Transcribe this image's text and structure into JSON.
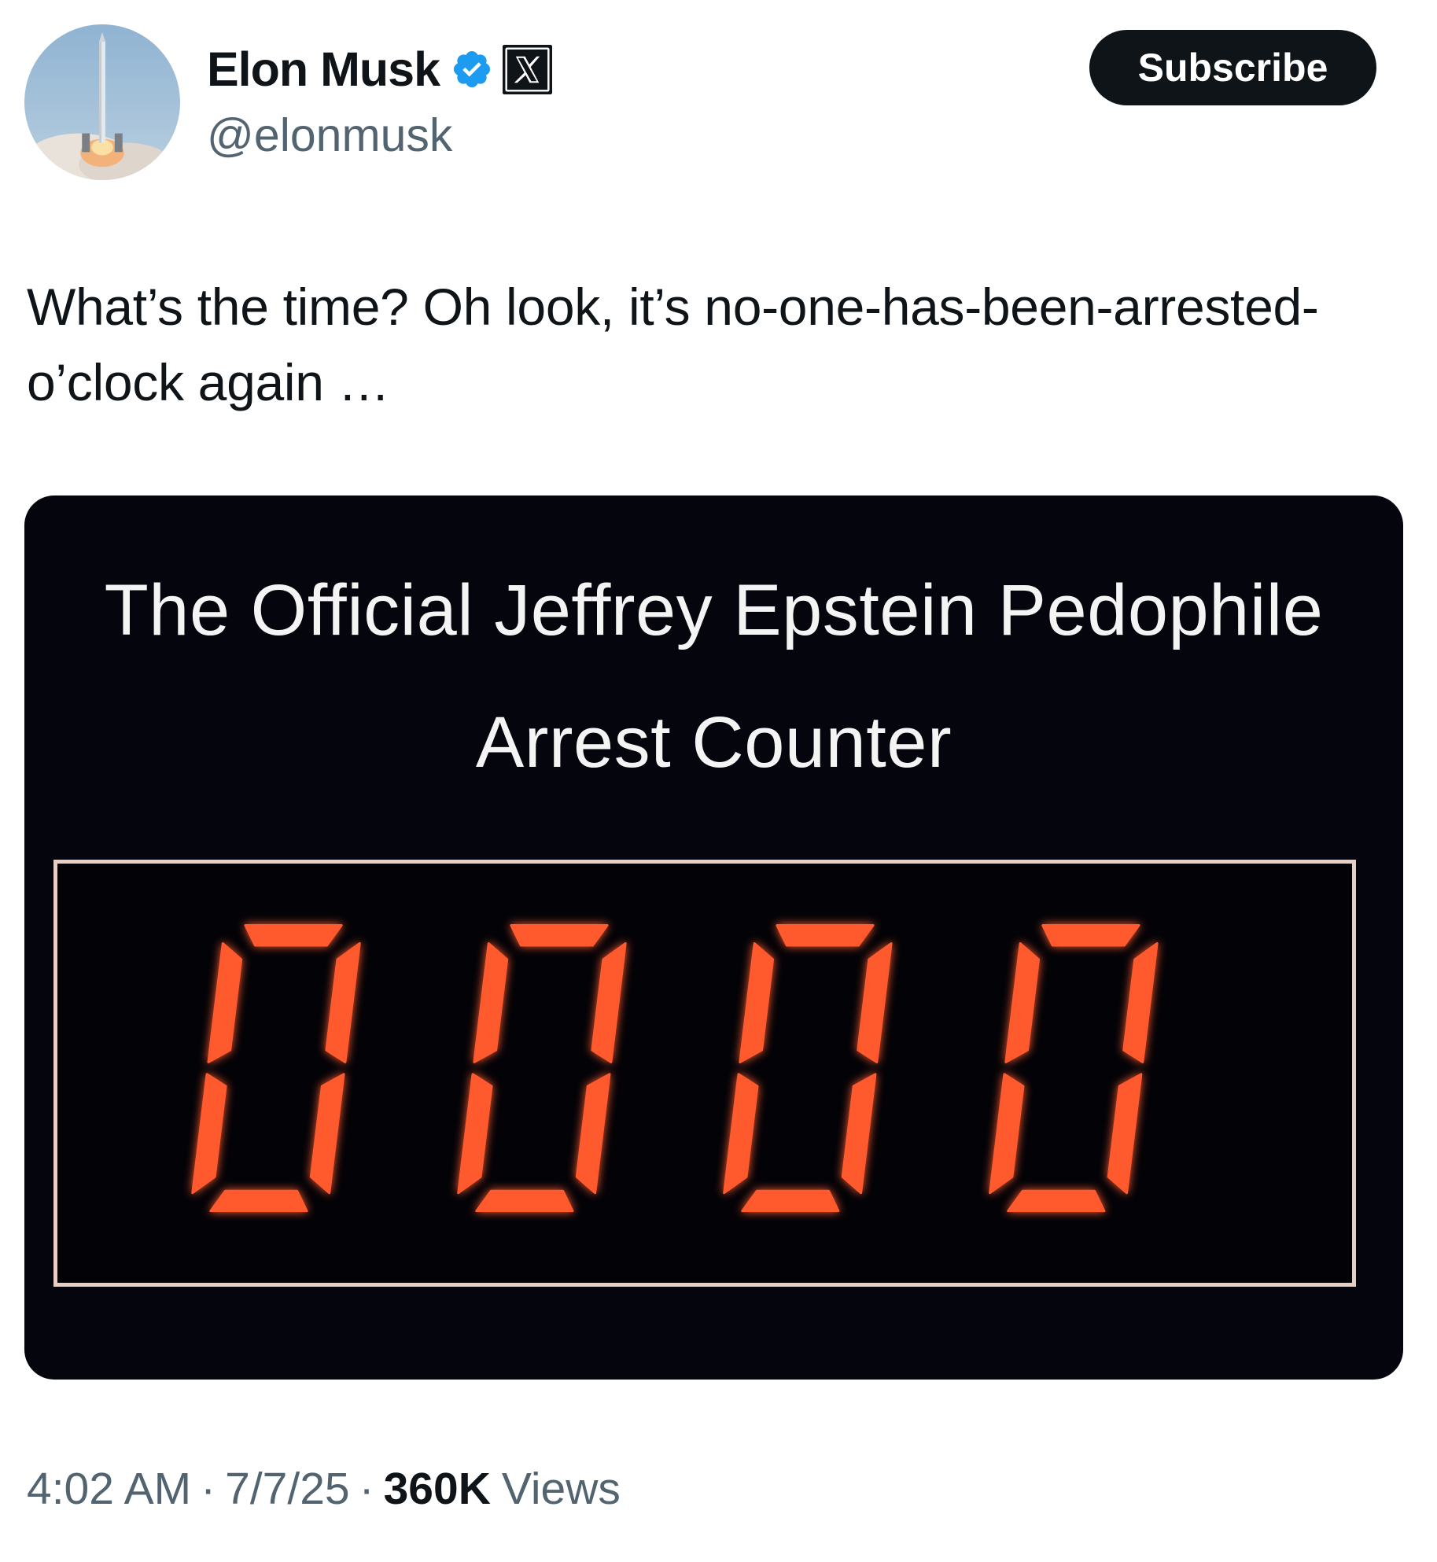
{
  "author": {
    "display_name": "Elon Musk",
    "handle": "@elonmusk",
    "avatar_icon": "rocket-launch-avatar",
    "verified_icon": "verified-badge-icon",
    "affiliate_icon": "x-logo-icon"
  },
  "actions": {
    "subscribe_label": "Subscribe"
  },
  "tweet": {
    "text": "What’s the time? Oh look, it’s no-one-has-been-arrested-o’clock again …"
  },
  "media": {
    "title": "The Official Jeffrey Epstein Pedophile Arrest Counter",
    "counter_value": "0000"
  },
  "meta": {
    "time": "4:02 AM",
    "separator": "·",
    "date": "7/7/25",
    "views_count": "360K",
    "views_label": "Views"
  },
  "colors": {
    "text_primary": "#0f1419",
    "text_secondary": "#536471",
    "verified_blue": "#1d9bf0",
    "counter_segment": "#ff5a2e",
    "media_background": "#05050d"
  }
}
